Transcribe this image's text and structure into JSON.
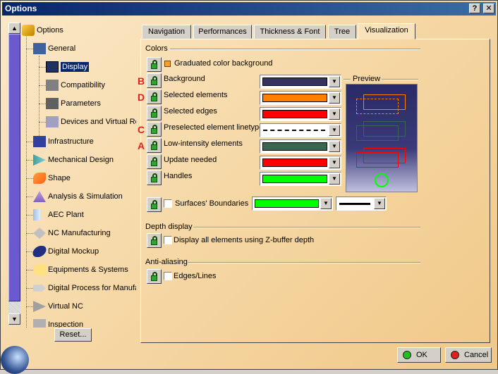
{
  "window": {
    "title": "Options",
    "help_label": "?",
    "close_label": "✕"
  },
  "tree": {
    "root": "Options",
    "items": [
      {
        "label": "General"
      },
      {
        "label": "Display"
      },
      {
        "label": "Compatibility"
      },
      {
        "label": "Parameters"
      },
      {
        "label": "Devices and Virtual Re"
      },
      {
        "label": "Infrastructure"
      },
      {
        "label": "Mechanical Design"
      },
      {
        "label": "Shape"
      },
      {
        "label": "Analysis & Simulation"
      },
      {
        "label": "AEC Plant"
      },
      {
        "label": "NC Manufacturing"
      },
      {
        "label": "Digital Mockup"
      },
      {
        "label": "Equipments & Systems"
      },
      {
        "label": "Digital Process for Manufa"
      },
      {
        "label": "Virtual NC"
      },
      {
        "label": "Inspection"
      }
    ],
    "selected": "Display",
    "reset_label": "Reset..."
  },
  "tabs": [
    {
      "label": "Navigation"
    },
    {
      "label": "Performances"
    },
    {
      "label": "Thickness & Font"
    },
    {
      "label": "Tree"
    },
    {
      "label": "Visualization"
    }
  ],
  "active_tab": "Visualization",
  "colors": {
    "title": "Colors",
    "graduated_label": "Graduated color background",
    "rows": [
      {
        "label": "Background",
        "color": "#33335e",
        "annot": "B"
      },
      {
        "label": "Selected elements",
        "color": "#ff8000",
        "annot": "D"
      },
      {
        "label": "Selected edges",
        "color": "#ff0000",
        "annot": ""
      },
      {
        "label": "Preselected element linetype",
        "color": "",
        "annot": "C"
      },
      {
        "label": "Low-intensity elements",
        "color": "#3a6650",
        "annot": "A"
      },
      {
        "label": "Update needed",
        "color": "#ff0000",
        "annot": ""
      },
      {
        "label": "Handles",
        "color": "#00ff00",
        "annot": ""
      }
    ],
    "surfaces_label": "Surfaces' Boundaries",
    "surfaces_color": "#00ff00",
    "preview_title": "Preview"
  },
  "depth": {
    "title": "Depth display",
    "zbuffer_label": "Display all elements using Z-buffer depth"
  },
  "antialias": {
    "title": "Anti-aliasing",
    "edges_label": "Edges/Lines"
  },
  "buttons": {
    "ok_label": "OK",
    "cancel_label": "Cancel"
  }
}
